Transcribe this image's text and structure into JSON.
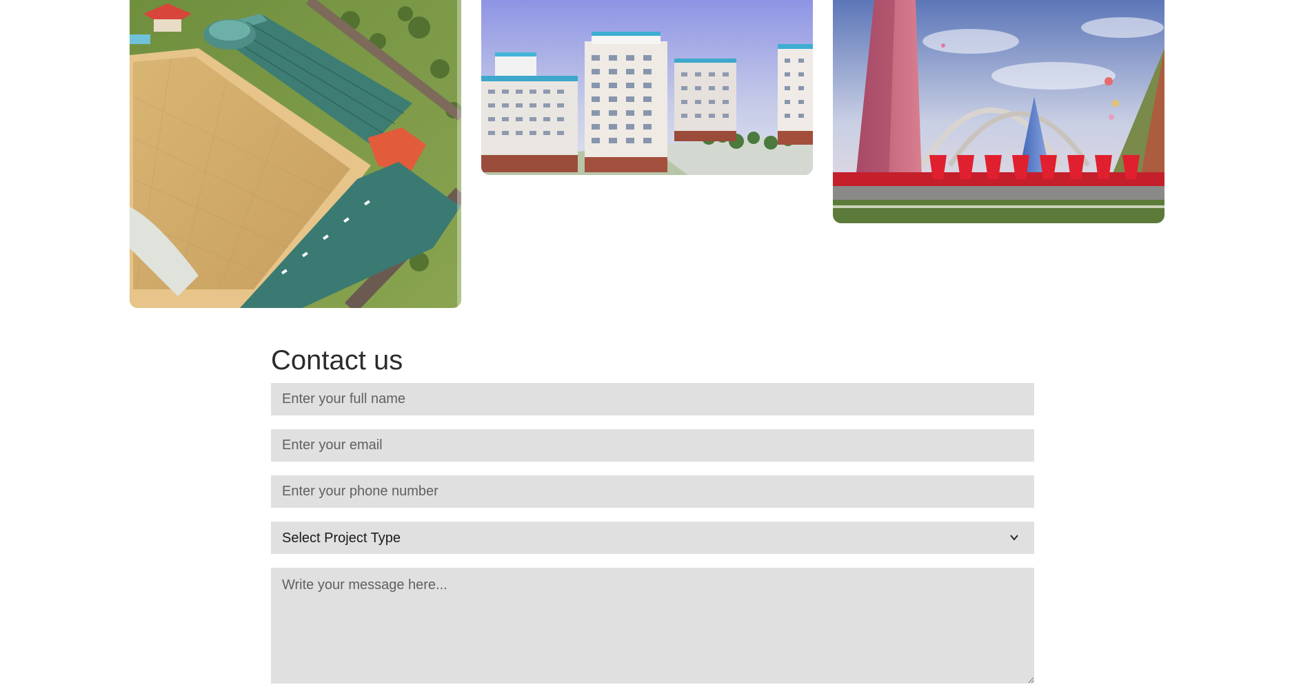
{
  "gallery": {
    "images": [
      {
        "id": "sports-complex",
        "alt": "Aerial rendering of sports complex"
      },
      {
        "id": "residential-towers",
        "alt": "Residential tower rendering"
      },
      {
        "id": "monument-arch",
        "alt": "Monument with arch and spires"
      }
    ]
  },
  "contact": {
    "title": "Contact us",
    "name_placeholder": "Enter your full name",
    "email_placeholder": "Enter your email",
    "phone_placeholder": "Enter your phone number",
    "project_type_selected": "Select Project Type",
    "message_placeholder": "Write your message here..."
  }
}
